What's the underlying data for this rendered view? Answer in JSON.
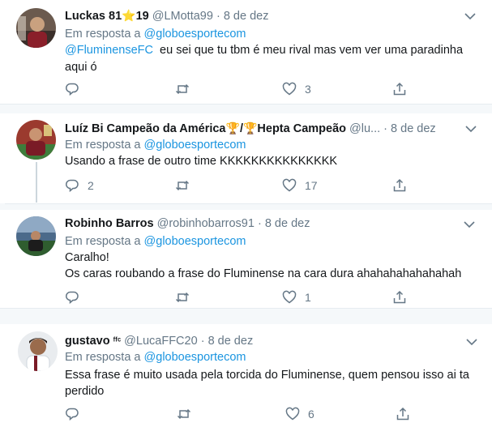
{
  "tweets": [
    {
      "name": "Luckas 81",
      "name_emoji": "⭐",
      "name_suffix": "19",
      "handle": "@LMotta99",
      "separator": "·",
      "date": "8 de dez",
      "reply_prefix": "Em resposta a",
      "reply_to": "@globoesportecom",
      "line1_mention": "@FluminenseFC",
      "line1_text": "  eu sei que tu tbm é meu rival mas vem ver uma paradinha",
      "line2_text": "aqui ó",
      "reply_count": "",
      "retweet_count": "",
      "like_count": "3"
    },
    {
      "name": "Luíz Bi Campeão da América",
      "name_emoji": "🏆",
      "name_slash": "/",
      "name_emoji2": "🏆",
      "name_suffix": "Hepta Campeão",
      "handle": "@lu...",
      "separator": "·",
      "date": "8 de dez",
      "reply_prefix": "Em resposta a",
      "reply_to": "@globoesportecom",
      "line1_text": "Usando a frase de outro time KKKKKKKKKKKKKKK",
      "reply_count": "2",
      "retweet_count": "",
      "like_count": "17"
    },
    {
      "name": "Robinho Barros",
      "handle": "@robinhobarros91",
      "separator": "·",
      "date": "8 de dez",
      "reply_prefix": "Em resposta a",
      "reply_to": "@globoesportecom",
      "line1_text": "Caralho!",
      "line2_text": "Os caras roubando a frase do Fluminense na cara dura ahahahahahahahah",
      "reply_count": "",
      "retweet_count": "",
      "like_count": "1"
    },
    {
      "name": "gustavo",
      "name_suffix": "ᶠᶠᶜ",
      "handle": "@LucaFFC20",
      "separator": "·",
      "date": "8 de dez",
      "reply_prefix": "Em resposta a",
      "reply_to": "@globoesportecom",
      "line1_text": "Essa frase é muito usada pela torcida do Fluminense, quem pensou isso ai ta",
      "line2_text": "perdido",
      "reply_count": "",
      "retweet_count": "",
      "like_count": "6"
    }
  ],
  "icons": {
    "reply": "reply-icon",
    "retweet": "retweet-icon",
    "like": "heart-icon",
    "share": "share-icon",
    "more": "chevron-down-icon"
  },
  "colors": {
    "link": "#1b95e0",
    "muted": "#657786",
    "text": "#14171a",
    "separator_bg": "#f5f8fa",
    "border": "#e6ecf0"
  }
}
